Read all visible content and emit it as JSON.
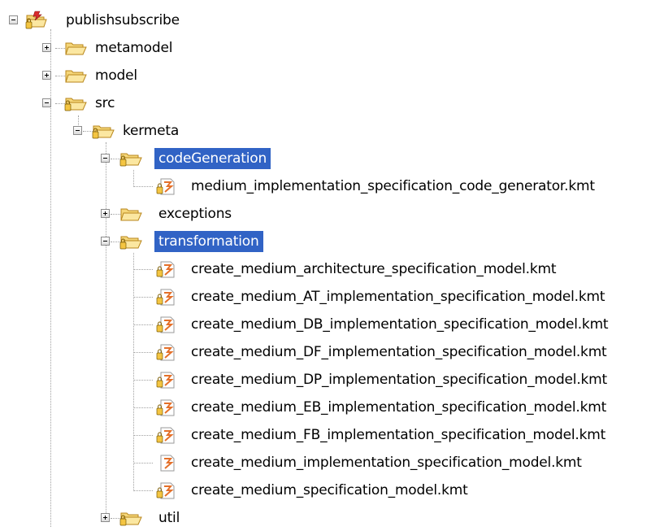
{
  "tree": {
    "root": {
      "label": "publishsubscribe",
      "expanded": true
    },
    "metamodel": {
      "label": "metamodel",
      "expanded": false
    },
    "model": {
      "label": "model",
      "expanded": false
    },
    "src": {
      "label": "src",
      "expanded": true
    },
    "kermeta": {
      "label": "kermeta",
      "expanded": true
    },
    "codeGeneration": {
      "label": "codeGeneration",
      "expanded": true,
      "selected": true,
      "files": [
        "medium_implementation_specification_code_generator.kmt"
      ]
    },
    "exceptions": {
      "label": "exceptions",
      "expanded": false
    },
    "transformation": {
      "label": "transformation",
      "expanded": true,
      "selected": true,
      "files": [
        "create_medium_architecture_specification_model.kmt",
        "create_medium_AT_implementation_specification_model.kmt",
        "create_medium_DB_implementation_specification_model.kmt",
        "create_medium_DF_implementation_specification_model.kmt",
        "create_medium_DP_implementation_specification_model.kmt",
        "create_medium_EB_implementation_specification_model.kmt",
        "create_medium_FB_implementation_specification_model.kmt",
        "create_medium_implementation_specification_model.kmt",
        "create_medium_specification_model.kmt"
      ]
    },
    "util": {
      "label": "util",
      "expanded": false
    }
  },
  "colors": {
    "selection": "#3163c5",
    "folder_fill": "#f5d679",
    "folder_stroke": "#b8861b",
    "file_accent": "#e4702a"
  }
}
